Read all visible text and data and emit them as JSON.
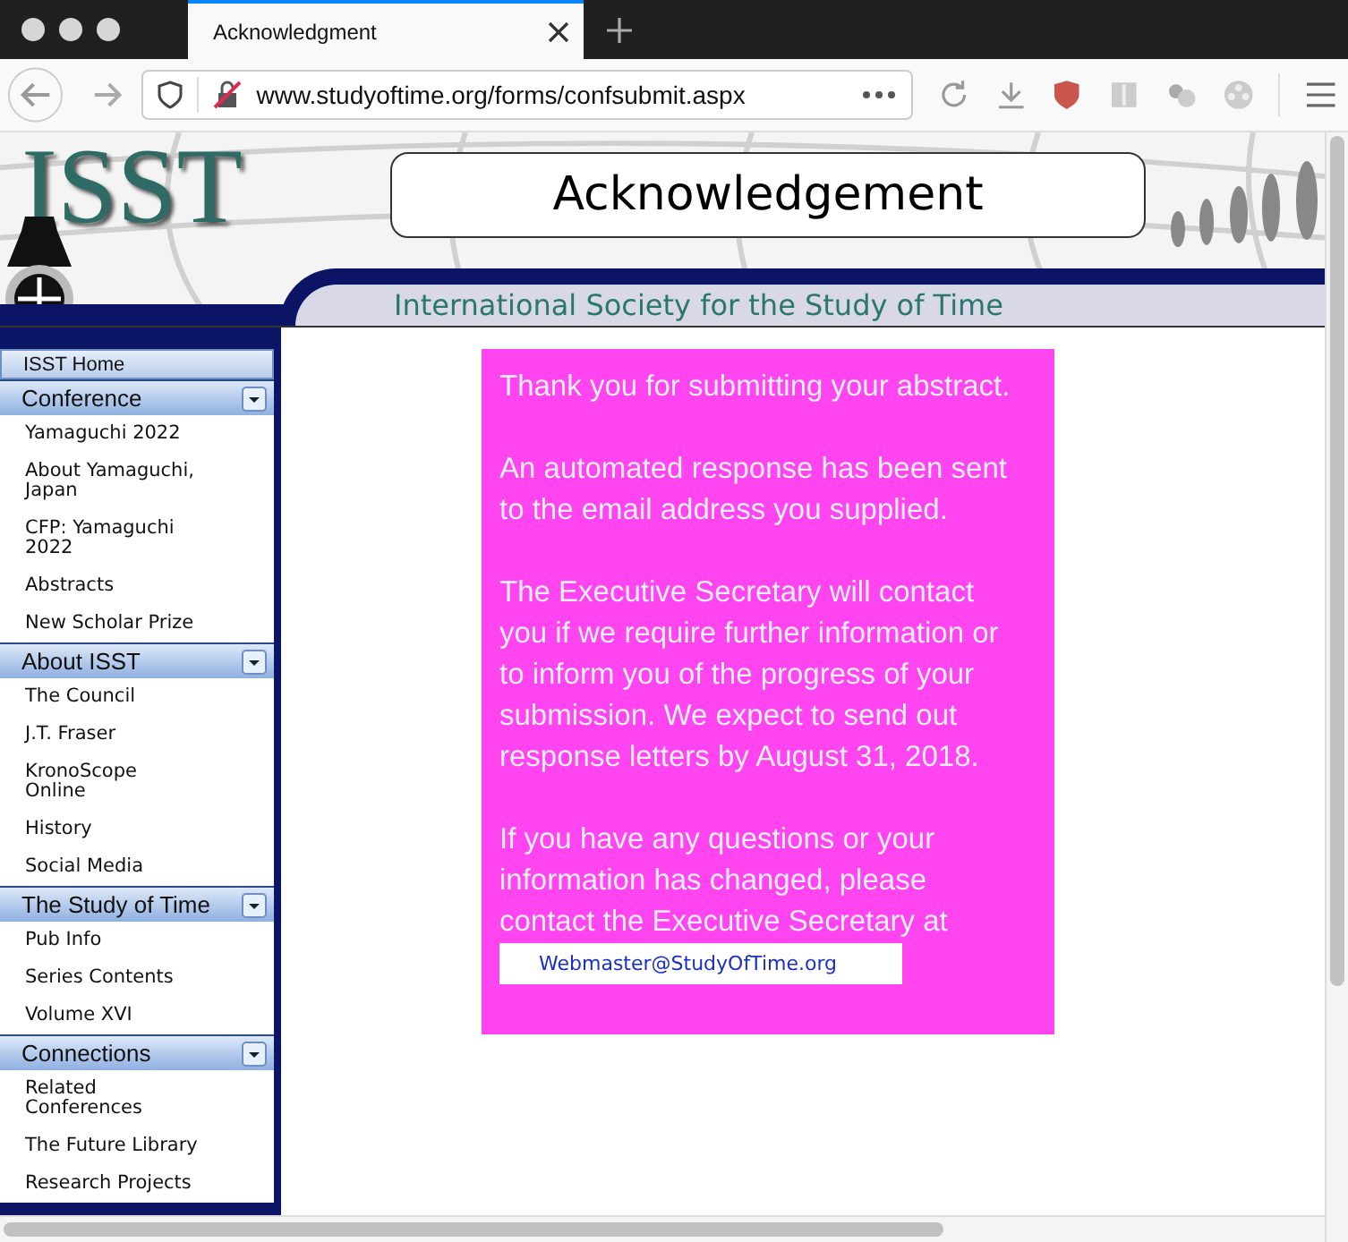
{
  "browser": {
    "tab_title": "Acknowledgment",
    "url": "www.studyoftime.org/forms/confsubmit.aspx"
  },
  "banner": {
    "logo": "ISST",
    "heading": "Acknowledgement",
    "subtitle": "International Society for the Study of Time"
  },
  "sidebar": {
    "home": "ISST Home",
    "sections": [
      {
        "title": "Conference",
        "items": [
          "Yamaguchi 2022",
          "About Yamaguchi, Japan",
          "CFP: Yamaguchi 2022",
          "Abstracts",
          "New Scholar Prize"
        ]
      },
      {
        "title": "About ISST",
        "items": [
          "The Council",
          "J.T. Fraser",
          "KronoScope Online",
          "History",
          "Social Media"
        ]
      },
      {
        "title": "The Study of Time",
        "items": [
          "Pub Info",
          "Series Contents",
          "Volume XVI"
        ]
      },
      {
        "title": "Connections",
        "items": [
          "Related Conferences",
          "The Future Library",
          "Research Projects"
        ]
      }
    ]
  },
  "message": {
    "paragraphs": [
      "Thank you for submitting your abstract.",
      "An automated response has been sent to the email address you supplied.",
      "The Executive Secretary will contact you if we require further information or to inform you of the progress of your submission. We expect to send out response letters by August 31, 2018.",
      "If you have any questions or your information has changed, please contact the Executive Secretary at"
    ],
    "email": "Webmaster@StudyOfTime.org"
  }
}
